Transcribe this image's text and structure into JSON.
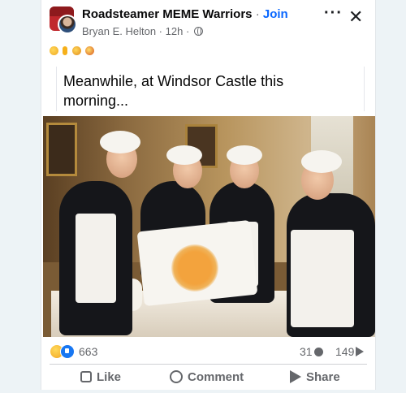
{
  "header": {
    "group_name": "Roadsteamer MEME Warriors",
    "separator": "·",
    "join_label": "Join",
    "author": "Bryan E. Helton",
    "timestamp": "12h",
    "meta_separator": "·",
    "more_icon": "more-horizontal-icon",
    "close_icon": "close-icon"
  },
  "emoji_row": [
    "laughing-emoji",
    "finger-emoji",
    "hand-emoji",
    "crying-laughing-emoji"
  ],
  "post": {
    "text": "Meanwhile, at Windsor Castle this morning..."
  },
  "reactions": {
    "count": "663",
    "comments": "31",
    "shares": "149"
  },
  "actions": {
    "like": "Like",
    "comment": "Comment",
    "share": "Share"
  }
}
